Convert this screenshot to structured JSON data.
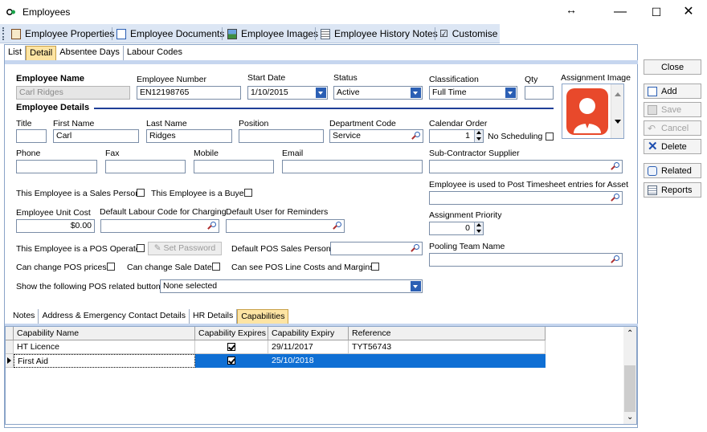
{
  "window": {
    "title": "Employees",
    "minimize": "—",
    "maximize": "☐",
    "close": "✕",
    "resize_glyph": "↔"
  },
  "toolbar": {
    "items": [
      {
        "label": "Employee Properties",
        "icon": "properties-icon"
      },
      {
        "label": "Employee Documents",
        "icon": "document-icon"
      },
      {
        "label": "Employee Images",
        "icon": "image-icon"
      },
      {
        "label": "Employee History Notes",
        "icon": "notes-icon"
      },
      {
        "label": "Customise",
        "icon": "checkbox-icon"
      }
    ]
  },
  "tabs": [
    "List",
    "Detail",
    "Absentee Days",
    "Labour Codes"
  ],
  "active_tab": "Detail",
  "form": {
    "employee_name_label": "Employee Name",
    "employee_name_value": "Carl Ridges",
    "employee_number_label": "Employee Number",
    "employee_number_value": "EN12198765",
    "start_date_label": "Start Date",
    "start_date_value": "1/10/2015",
    "status_label": "Status",
    "status_value": "Active",
    "classification_label": "Classification",
    "classification_value": "Full Time",
    "qty_label": "Qty",
    "qty_value": "",
    "assignment_image_label": "Assignment Image",
    "employee_details_heading": "Employee Details",
    "title_label": "Title",
    "title_value": "",
    "first_name_label": "First Name",
    "first_name_value": "Carl",
    "last_name_label": "Last Name",
    "last_name_value": "Ridges",
    "position_label": "Position",
    "position_value": "",
    "department_code_label": "Department Code",
    "department_code_value": "Service",
    "calendar_order_label": "Calendar Order",
    "calendar_order_value": "1",
    "no_scheduling_label": "No Scheduling",
    "phone_label": "Phone",
    "fax_label": "Fax",
    "mobile_label": "Mobile",
    "email_label": "Email",
    "subcontractor_label": "Sub-Contractor Supplier",
    "sales_person_label": "This Employee is a Sales Person",
    "buyer_label": "This Employee is a Buyer",
    "post_timesheet_label": "Employee is used to Post Timesheet entries for Asset",
    "unit_cost_label": "Employee Unit Cost",
    "unit_cost_value": "$0.00",
    "default_labour_label": "Default Labour Code for Charging",
    "default_user_label": "Default User for Reminders",
    "assignment_priority_label": "Assignment Priority",
    "assignment_priority_value": "0",
    "pos_operator_label": "This Employee is a POS Operator",
    "set_password_label": "Set Password",
    "default_pos_label": "Default POS Sales Person",
    "pooling_team_label": "Pooling Team Name",
    "change_prices_label": "Can change POS prices",
    "change_sale_date_label": "Can change Sale Date",
    "see_pos_costs_label": "Can see POS Line Costs and Margins",
    "pos_buttons_label": "Show the following POS related buttons",
    "pos_buttons_value": "None selected"
  },
  "side_buttons": {
    "close": "Close",
    "add": "Add",
    "save": "Save",
    "cancel": "Cancel",
    "delete": "Delete",
    "related": "Related",
    "reports": "Reports"
  },
  "bottom_tabs": [
    "Notes",
    "Address & Emergency Contact Details",
    "HR Details",
    "Capabilities"
  ],
  "bottom_active_tab": "Capabilities",
  "grid": {
    "columns": [
      "Capability Name",
      "Capability Expires",
      "Capability Expiry",
      "Reference"
    ],
    "rows": [
      {
        "name": "HT Licence",
        "expires": true,
        "expiry": "29/11/2017",
        "reference": "TYT56743",
        "selected": false
      },
      {
        "name": "First Aid",
        "expires": true,
        "expiry": "25/10/2018",
        "reference": "",
        "selected": true
      }
    ]
  },
  "colors": {
    "accent": "#0f6fd4",
    "toolbar": "#dce6f4",
    "active_tab": "#fde4a3",
    "avatar": "#e8492b"
  }
}
